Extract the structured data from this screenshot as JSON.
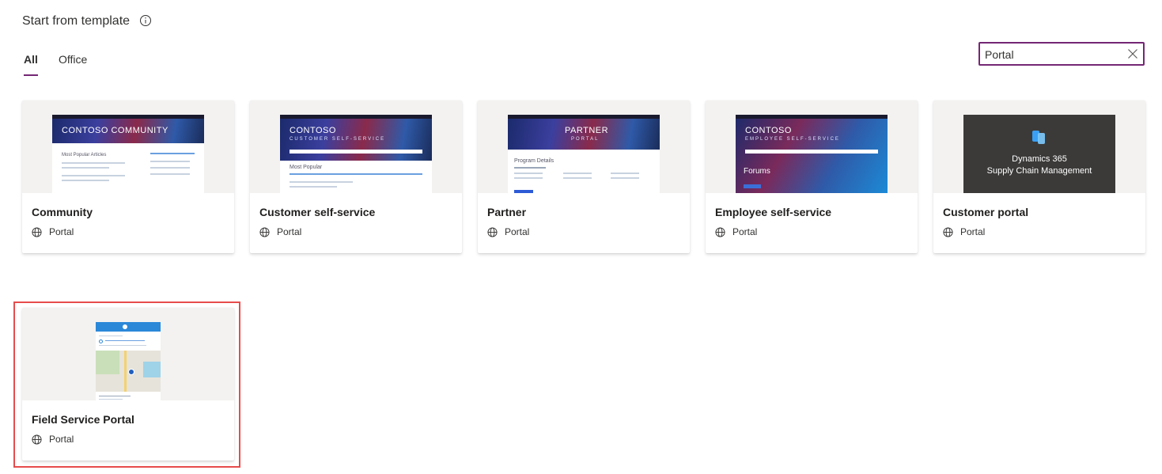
{
  "header": {
    "title": "Start from template"
  },
  "tabs": [
    {
      "label": "All",
      "active": true
    },
    {
      "label": "Office",
      "active": false
    }
  ],
  "search": {
    "value": "Portal"
  },
  "cards": [
    {
      "name": "Community",
      "type": "Portal",
      "thumb_title": "CONTOSO COMMUNITY",
      "thumb_section": "Most Popular Articles"
    },
    {
      "name": "Customer self-service",
      "type": "Portal",
      "thumb_title": "CONTOSO",
      "thumb_sub": "CUSTOMER SELF-SERVICE",
      "thumb_section": "Most Popular"
    },
    {
      "name": "Partner",
      "type": "Portal",
      "thumb_title": "PARTNER",
      "thumb_sub": "PORTAL",
      "thumb_section": "Program Details"
    },
    {
      "name": "Employee self-service",
      "type": "Portal",
      "thumb_title": "CONTOSO",
      "thumb_sub": "EMPLOYEE SELF-SERVICE",
      "thumb_section": "Forums"
    },
    {
      "name": "Customer portal",
      "type": "Portal",
      "thumb_line1": "Dynamics 365",
      "thumb_line2": "Supply Chain Management"
    },
    {
      "name": "Field Service Portal",
      "type": "Portal",
      "selected": true
    }
  ],
  "colors": {
    "accent": "#742774",
    "selection_border": "#e74c4c"
  }
}
